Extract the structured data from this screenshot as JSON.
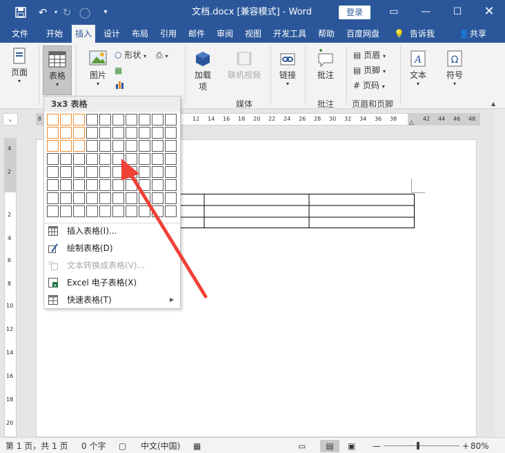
{
  "window": {
    "title": "文档.docx [兼容模式]  -  Word",
    "login_label": "登录"
  },
  "tabs": [
    "文件",
    "开始",
    "插入",
    "设计",
    "布局",
    "引用",
    "邮件",
    "审阅",
    "视图",
    "开发工具",
    "帮助",
    "百度网盘",
    "告诉我",
    "共享"
  ],
  "ribbon": {
    "page": "页面",
    "table": "表格",
    "picture": "图片",
    "shapes": "形状",
    "addin_line1": "加载",
    "addin_line2": "项",
    "online_video": "联机视频",
    "media_group": "媒体",
    "link": "链接",
    "comment": "批注",
    "comment_group": "批注",
    "header": "页眉",
    "footer": "页脚",
    "page_number": "页码",
    "header_footer_group": "页眉和页脚",
    "text": "文本",
    "symbol": "符号"
  },
  "ruler": {
    "h_ticks": [
      "8",
      "12",
      "14",
      "16",
      "18",
      "20",
      "22",
      "24",
      "26",
      "28",
      "30",
      "32",
      "34",
      "36",
      "38",
      "42",
      "44",
      "46",
      "48"
    ],
    "v_ticks": [
      "4",
      "2",
      "2",
      "4",
      "6",
      "8",
      "10",
      "12",
      "14",
      "16",
      "18",
      "20"
    ]
  },
  "dropdown": {
    "header": "3x3 表格",
    "selected_rows": 3,
    "selected_cols": 3,
    "items": [
      {
        "label": "插入表格(I)...",
        "enabled": true
      },
      {
        "label": "绘制表格(D)",
        "enabled": true
      },
      {
        "label": "文本转换成表格(V)...",
        "enabled": false
      },
      {
        "label": "Excel 电子表格(X)",
        "enabled": true
      },
      {
        "label": "快速表格(T)",
        "enabled": true
      }
    ]
  },
  "status": {
    "page": "第 1 页，共 1 页",
    "words": "0 个字",
    "language": "中文(中国)",
    "zoom": "80%"
  },
  "colors": {
    "word_blue": "#2b579a",
    "selected_cell": "#e98a2c",
    "arrow": "#ef4136"
  }
}
